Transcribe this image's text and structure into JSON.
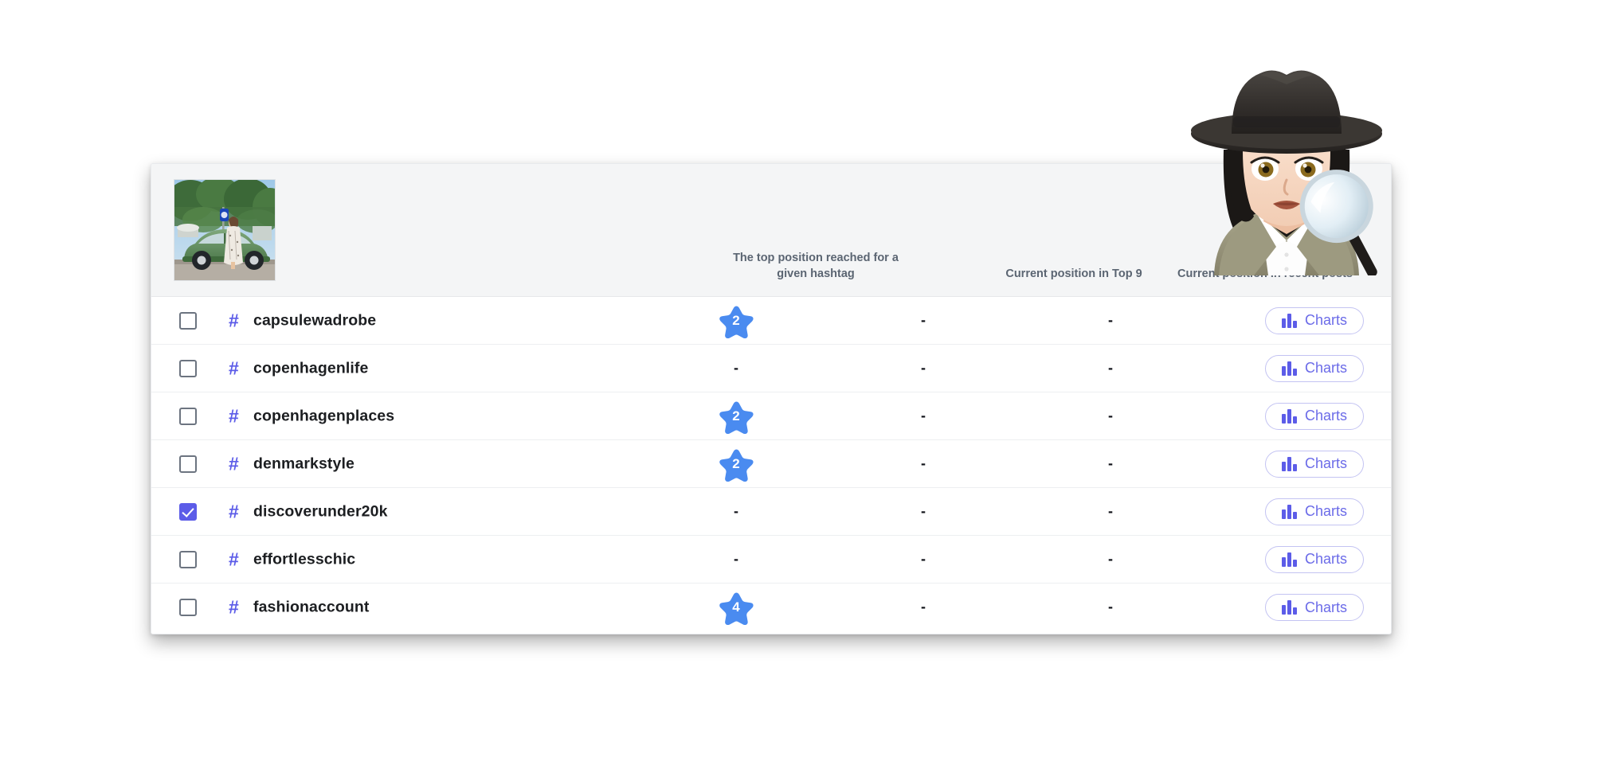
{
  "card": {
    "thumbnail_alt": "woman in floral maxi dress beside green vintage beetle car",
    "columns": [
      {
        "key": "top_position",
        "label": "The top position reached for a given hashtag"
      },
      {
        "key": "current_top9",
        "label": "Current position in Top 9"
      },
      {
        "key": "current_recent",
        "label": "Current position in recent posts"
      }
    ],
    "charts_button_label": "Charts",
    "hash_symbol": "#",
    "empty_value": "-",
    "rows": [
      {
        "name": "capsulewadrobe",
        "checked": false,
        "top_position": "2",
        "current_top9": "-",
        "current_recent": "-"
      },
      {
        "name": "copenhagenlife",
        "checked": false,
        "top_position": "-",
        "current_top9": "-",
        "current_recent": "-"
      },
      {
        "name": "copenhagenplaces",
        "checked": false,
        "top_position": "2",
        "current_top9": "-",
        "current_recent": "-"
      },
      {
        "name": "denmarkstyle",
        "checked": false,
        "top_position": "2",
        "current_top9": "-",
        "current_recent": "-"
      },
      {
        "name": "discoverunder20k",
        "checked": true,
        "top_position": "-",
        "current_top9": "-",
        "current_recent": "-"
      },
      {
        "name": "effortlesschic",
        "checked": false,
        "top_position": "-",
        "current_top9": "-",
        "current_recent": "-"
      },
      {
        "name": "fashionaccount",
        "checked": false,
        "top_position": "4",
        "current_top9": "-",
        "current_recent": "-"
      }
    ]
  },
  "overlay": {
    "emoji_name": "woman-detective-emoji",
    "emoji_char": "🕵️‍♀️"
  },
  "colors": {
    "accent_purple": "#5c5ce8",
    "star_blue": "#4a8bf0",
    "header_bg": "#f4f5f6",
    "row_border": "#edeff1",
    "header_text": "#5b6572",
    "tag_text": "#1c1e21",
    "button_border": "#c3c3f2",
    "button_text": "#6b6be8"
  }
}
